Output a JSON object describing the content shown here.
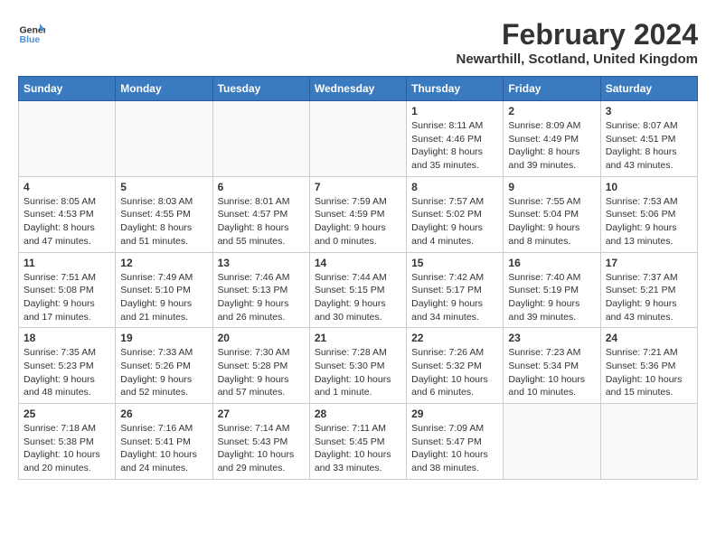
{
  "header": {
    "logo_line1": "General",
    "logo_line2": "Blue",
    "month_title": "February 2024",
    "subtitle": "Newarthill, Scotland, United Kingdom"
  },
  "days_of_week": [
    "Sunday",
    "Monday",
    "Tuesday",
    "Wednesday",
    "Thursday",
    "Friday",
    "Saturday"
  ],
  "weeks": [
    [
      {
        "day": "",
        "info": ""
      },
      {
        "day": "",
        "info": ""
      },
      {
        "day": "",
        "info": ""
      },
      {
        "day": "",
        "info": ""
      },
      {
        "day": "1",
        "info": "Sunrise: 8:11 AM\nSunset: 4:46 PM\nDaylight: 8 hours\nand 35 minutes."
      },
      {
        "day": "2",
        "info": "Sunrise: 8:09 AM\nSunset: 4:49 PM\nDaylight: 8 hours\nand 39 minutes."
      },
      {
        "day": "3",
        "info": "Sunrise: 8:07 AM\nSunset: 4:51 PM\nDaylight: 8 hours\nand 43 minutes."
      }
    ],
    [
      {
        "day": "4",
        "info": "Sunrise: 8:05 AM\nSunset: 4:53 PM\nDaylight: 8 hours\nand 47 minutes."
      },
      {
        "day": "5",
        "info": "Sunrise: 8:03 AM\nSunset: 4:55 PM\nDaylight: 8 hours\nand 51 minutes."
      },
      {
        "day": "6",
        "info": "Sunrise: 8:01 AM\nSunset: 4:57 PM\nDaylight: 8 hours\nand 55 minutes."
      },
      {
        "day": "7",
        "info": "Sunrise: 7:59 AM\nSunset: 4:59 PM\nDaylight: 9 hours\nand 0 minutes."
      },
      {
        "day": "8",
        "info": "Sunrise: 7:57 AM\nSunset: 5:02 PM\nDaylight: 9 hours\nand 4 minutes."
      },
      {
        "day": "9",
        "info": "Sunrise: 7:55 AM\nSunset: 5:04 PM\nDaylight: 9 hours\nand 8 minutes."
      },
      {
        "day": "10",
        "info": "Sunrise: 7:53 AM\nSunset: 5:06 PM\nDaylight: 9 hours\nand 13 minutes."
      }
    ],
    [
      {
        "day": "11",
        "info": "Sunrise: 7:51 AM\nSunset: 5:08 PM\nDaylight: 9 hours\nand 17 minutes."
      },
      {
        "day": "12",
        "info": "Sunrise: 7:49 AM\nSunset: 5:10 PM\nDaylight: 9 hours\nand 21 minutes."
      },
      {
        "day": "13",
        "info": "Sunrise: 7:46 AM\nSunset: 5:13 PM\nDaylight: 9 hours\nand 26 minutes."
      },
      {
        "day": "14",
        "info": "Sunrise: 7:44 AM\nSunset: 5:15 PM\nDaylight: 9 hours\nand 30 minutes."
      },
      {
        "day": "15",
        "info": "Sunrise: 7:42 AM\nSunset: 5:17 PM\nDaylight: 9 hours\nand 34 minutes."
      },
      {
        "day": "16",
        "info": "Sunrise: 7:40 AM\nSunset: 5:19 PM\nDaylight: 9 hours\nand 39 minutes."
      },
      {
        "day": "17",
        "info": "Sunrise: 7:37 AM\nSunset: 5:21 PM\nDaylight: 9 hours\nand 43 minutes."
      }
    ],
    [
      {
        "day": "18",
        "info": "Sunrise: 7:35 AM\nSunset: 5:23 PM\nDaylight: 9 hours\nand 48 minutes."
      },
      {
        "day": "19",
        "info": "Sunrise: 7:33 AM\nSunset: 5:26 PM\nDaylight: 9 hours\nand 52 minutes."
      },
      {
        "day": "20",
        "info": "Sunrise: 7:30 AM\nSunset: 5:28 PM\nDaylight: 9 hours\nand 57 minutes."
      },
      {
        "day": "21",
        "info": "Sunrise: 7:28 AM\nSunset: 5:30 PM\nDaylight: 10 hours\nand 1 minute."
      },
      {
        "day": "22",
        "info": "Sunrise: 7:26 AM\nSunset: 5:32 PM\nDaylight: 10 hours\nand 6 minutes."
      },
      {
        "day": "23",
        "info": "Sunrise: 7:23 AM\nSunset: 5:34 PM\nDaylight: 10 hours\nand 10 minutes."
      },
      {
        "day": "24",
        "info": "Sunrise: 7:21 AM\nSunset: 5:36 PM\nDaylight: 10 hours\nand 15 minutes."
      }
    ],
    [
      {
        "day": "25",
        "info": "Sunrise: 7:18 AM\nSunset: 5:38 PM\nDaylight: 10 hours\nand 20 minutes."
      },
      {
        "day": "26",
        "info": "Sunrise: 7:16 AM\nSunset: 5:41 PM\nDaylight: 10 hours\nand 24 minutes."
      },
      {
        "day": "27",
        "info": "Sunrise: 7:14 AM\nSunset: 5:43 PM\nDaylight: 10 hours\nand 29 minutes."
      },
      {
        "day": "28",
        "info": "Sunrise: 7:11 AM\nSunset: 5:45 PM\nDaylight: 10 hours\nand 33 minutes."
      },
      {
        "day": "29",
        "info": "Sunrise: 7:09 AM\nSunset: 5:47 PM\nDaylight: 10 hours\nand 38 minutes."
      },
      {
        "day": "",
        "info": ""
      },
      {
        "day": "",
        "info": ""
      }
    ]
  ]
}
